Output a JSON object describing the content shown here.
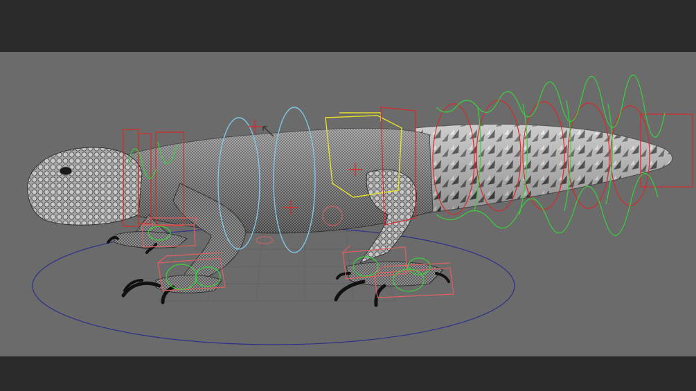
{
  "viewport": {
    "background": "#6b6b6b",
    "letterbox": "#2a2a2a",
    "colors": {
      "ground_circle": "#2a2f8a",
      "ik_box": "#e06060",
      "fk_ctrl": "#3ad13a",
      "spine_ctrl": "#7fc6e6",
      "hip_ctrl": "#e8e02a",
      "tail_ctrl": "#d62a2a",
      "mesh_light": "#d8d8d8",
      "mesh_dark": "#2c2c2c",
      "claw": "#111111"
    }
  }
}
